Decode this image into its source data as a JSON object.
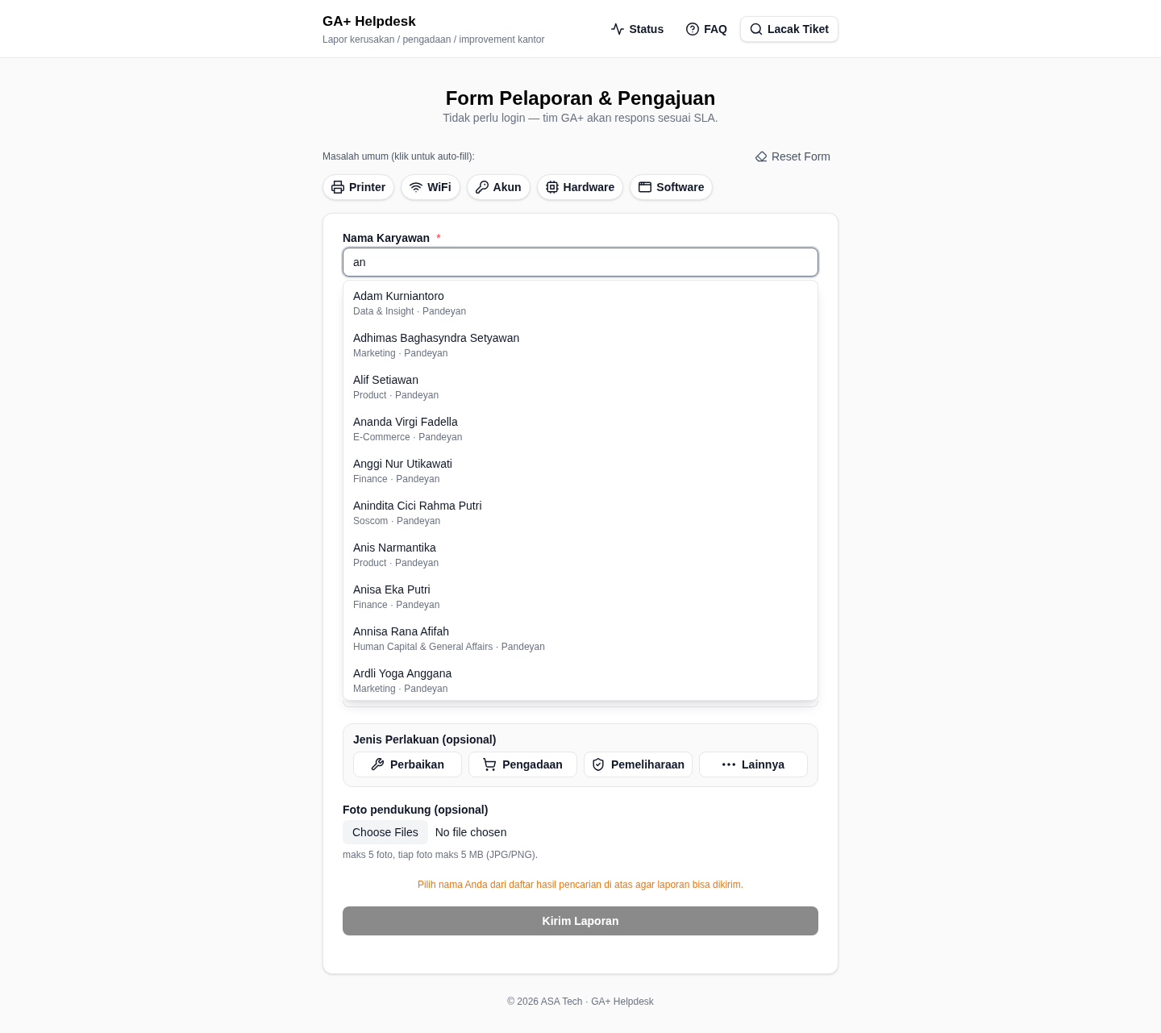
{
  "header": {
    "title": "GA+ Helpdesk",
    "subtitle": "Lapor kerusakan / pengadaan / improvement kantor",
    "nav": [
      {
        "label": "Status",
        "kind": "link"
      },
      {
        "label": "FAQ",
        "kind": "link"
      },
      {
        "label": "Lacak Tiket",
        "kind": "button"
      }
    ]
  },
  "intro": {
    "title": "Form Pelaporan & Pengajuan",
    "subtitle": "Tidak perlu login — tim GA+ akan respons sesuai SLA."
  },
  "quick_issues": {
    "label": "Masalah umum (klik untuk auto-fill):",
    "reset_button": "Reset Form",
    "chips": [
      "Printer",
      "WiFi",
      "Akun",
      "Hardware",
      "Software"
    ]
  },
  "form": {
    "employee_field": {
      "label": "Nama Karyawan",
      "required_mark": "*",
      "value": "an",
      "focused": true,
      "suggestions": [
        {
          "name": "Adam Kurniantoro",
          "detail": "Data & Insight · Pandeyan"
        },
        {
          "name": "Adhimas Baghasyndra Setyawan",
          "detail": "Marketing · Pandeyan"
        },
        {
          "name": "Alif Setiawan",
          "detail": "Product · Pandeyan"
        },
        {
          "name": "Ananda Virgi Fadella",
          "detail": "E-Commerce · Pandeyan"
        },
        {
          "name": "Anggi Nur Utikawati",
          "detail": "Finance · Pandeyan"
        },
        {
          "name": "Anindita Cici Rahma Putri",
          "detail": "Soscom · Pandeyan"
        },
        {
          "name": "Anis Narmantika",
          "detail": "Product · Pandeyan"
        },
        {
          "name": "Anisa Eka Putri",
          "detail": "Finance · Pandeyan"
        },
        {
          "name": "Annisa Rana Afifah",
          "detail": "Human Capital & General Affairs · Pandeyan"
        },
        {
          "name": "Ardli Yoga Anggana",
          "detail": "Marketing · Pandeyan"
        }
      ]
    },
    "treatment": {
      "title": "Jenis Perlakuan (opsional)",
      "options": [
        {
          "label": "Perbaikan",
          "selected": false
        },
        {
          "label": "Pengadaan",
          "selected": false
        },
        {
          "label": "Pemeliharaan",
          "selected": false
        },
        {
          "label": "Lainnya",
          "selected": false
        }
      ]
    },
    "photos": {
      "label": "Foto pendukung (opsional)",
      "button": "Choose Files",
      "status": "No file chosen",
      "hint": "maks 5 foto, tiap foto maks 5 MB (JPG/PNG)."
    },
    "warning": "Pilih nama Anda dari daftar hasil pencarian di atas agar laporan bisa dikirim.",
    "submit": {
      "label": "Kirim Laporan",
      "disabled": true
    }
  },
  "footer": "© 2026 ASA Tech · GA+ Helpdesk"
}
